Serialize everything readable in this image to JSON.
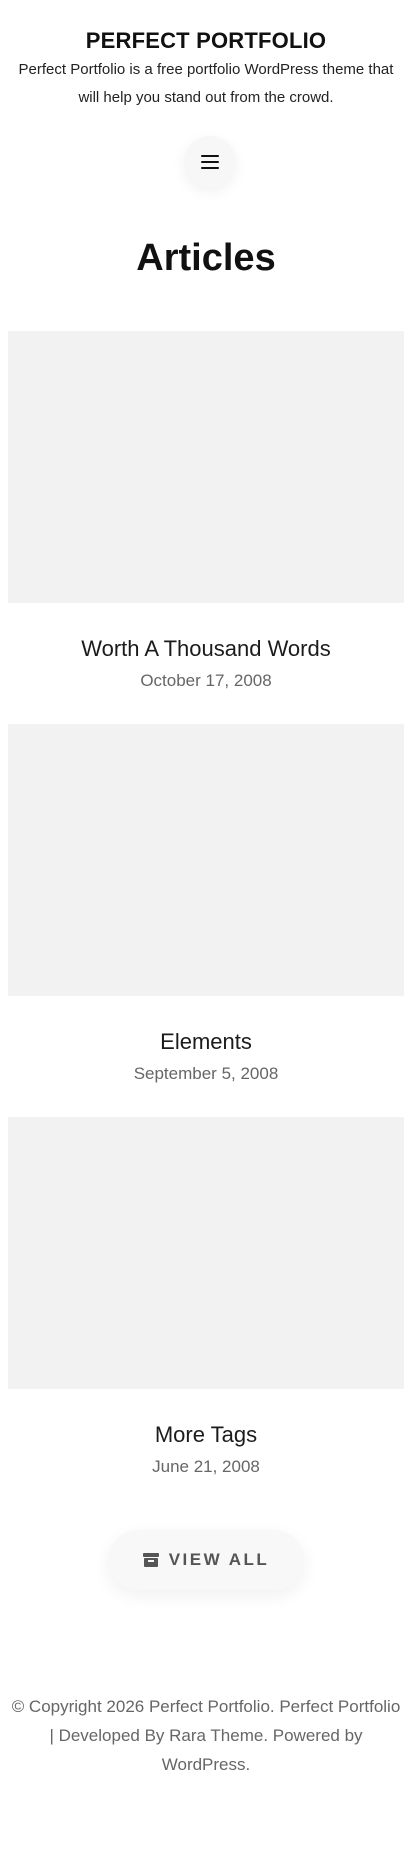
{
  "header": {
    "site_title": "PERFECT PORTFOLIO",
    "site_description": "Perfect Portfolio is a free portfolio WordPress theme that will help you stand out from the crowd.",
    "menu_icon": "hamburger-menu-icon"
  },
  "section": {
    "heading": "Articles",
    "highlight_color": "#d4f7ea"
  },
  "posts": [
    {
      "title": "Worth A Thousand Words",
      "date": "October 17, 2008"
    },
    {
      "title": "Elements",
      "date": "September 5, 2008"
    },
    {
      "title": "More Tags",
      "date": "June 21, 2008"
    }
  ],
  "view_all": {
    "label": "VIEW ALL",
    "icon": "archive-icon"
  },
  "footer": {
    "text": "© Copyright 2026 Perfect Portfolio. Perfect Portfolio | Developed By Rara Theme. Powered by WordPress."
  }
}
